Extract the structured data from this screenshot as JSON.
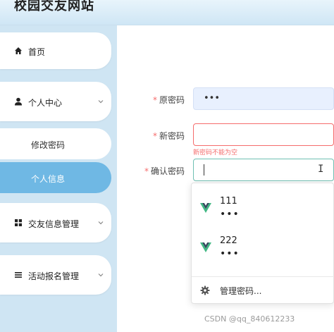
{
  "header": {
    "title": "校园交友网站"
  },
  "sidebar": {
    "items": [
      {
        "label": "首页",
        "icon": "home-icon"
      },
      {
        "label": "个人中心",
        "icon": "user-icon",
        "expanded": true,
        "children": [
          {
            "label": "修改密码",
            "active": false
          },
          {
            "label": "个人信息",
            "active": true
          }
        ]
      },
      {
        "label": "交友信息管理",
        "icon": "grid-icon"
      },
      {
        "label": "活动报名管理",
        "icon": "list-icon"
      }
    ]
  },
  "form": {
    "old_password": {
      "label": "原密码",
      "value": "•••"
    },
    "new_password": {
      "label": "新密码",
      "value": "",
      "error": "新密码不能为空"
    },
    "confirm_password": {
      "label": "确认密码",
      "value": ""
    }
  },
  "autocomplete": {
    "entries": [
      {
        "name": "111",
        "masked": "•••"
      },
      {
        "name": "222",
        "masked": "•••"
      }
    ],
    "manage_label": "管理密码..."
  },
  "watermark": "CSDN @qq_840612233",
  "colors": {
    "accent": "#6fb8e4",
    "sidebar_bg": "#cfe5f3",
    "error": "#f56c6c",
    "focus": "#6fbfb2",
    "vue_green": "#41b883",
    "vue_dark": "#35495e"
  }
}
